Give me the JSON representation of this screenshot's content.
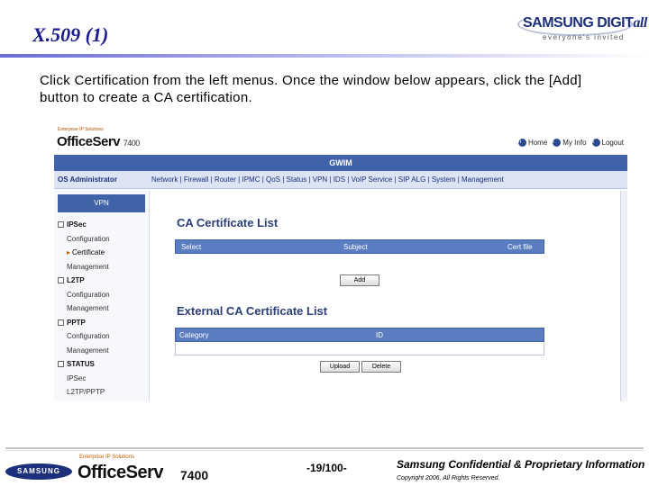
{
  "slide": {
    "title": "X.509 (1)",
    "brand_main": "SAMSUNG DIGIT",
    "brand_all": "all",
    "brand_tagline": "everyone's invited",
    "instructions": "Click Certification from the left menus. Once the window below appears, click the [Add] button to create a CA certification."
  },
  "screenshot": {
    "small_caption": "Enterprise IP Solutions",
    "logo_text": "OfficeServ",
    "logo_model": "7400",
    "links": [
      {
        "icon": "home-icon",
        "glyph": "h",
        "label": "Home"
      },
      {
        "icon": "info-icon",
        "glyph": "i",
        "label": "My Info"
      },
      {
        "icon": "logout-icon",
        "glyph": "x",
        "label": "Logout"
      }
    ],
    "bar_title": "GWIM",
    "admin_label": "OS Administrator",
    "menu_text": "Network | Firewall | Router | IPMC | QoS | Status | VPN | IDS | VoIP Service | SIP ALG | System | Management",
    "sidebar": {
      "header": "VPN",
      "items": [
        {
          "label": "IPSec",
          "kind": "sec"
        },
        {
          "label": "Configuration",
          "kind": "sub"
        },
        {
          "label": "Certificate",
          "kind": "active"
        },
        {
          "label": "Management",
          "kind": "sub"
        },
        {
          "label": "L2TP",
          "kind": "sec"
        },
        {
          "label": "Configuration",
          "kind": "sub"
        },
        {
          "label": "Management",
          "kind": "sub"
        },
        {
          "label": "PPTP",
          "kind": "sec"
        },
        {
          "label": "Configuration",
          "kind": "sub"
        },
        {
          "label": "Management",
          "kind": "sub"
        },
        {
          "label": "STATUS",
          "kind": "sec"
        },
        {
          "label": "IPSec",
          "kind": "sub"
        },
        {
          "label": "L2TP/PPTP",
          "kind": "sub"
        }
      ]
    },
    "ca_list": {
      "title": "CA Certificate List",
      "col_select": "Select",
      "col_subject": "Subject",
      "col_file": "Cert file",
      "add_button": "Add"
    },
    "ext_list": {
      "title": "External CA Certificate List",
      "col_category": "Category",
      "col_id": "ID",
      "upload_button": "Upload",
      "delete_button": "Delete"
    }
  },
  "footer": {
    "samsung": "SAMSUNG",
    "small_caption": "Enterprise IP Solutions",
    "logo_text": "OfficeServ",
    "logo_model": "7400",
    "page": "-19/100-",
    "confidential": "Samsung Confidential & Proprietary Information",
    "copyright": "Copyright 2006, All Rights Reserved."
  }
}
